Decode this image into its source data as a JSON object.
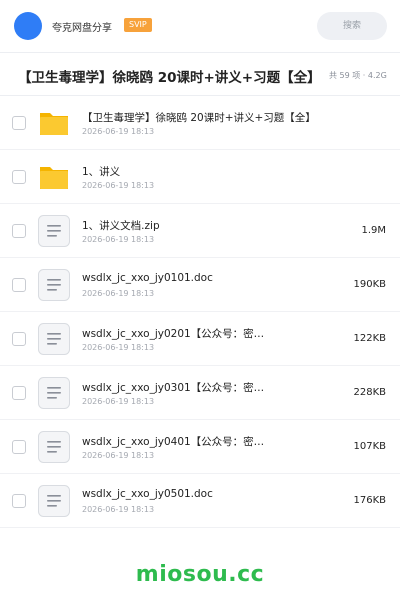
{
  "header": {
    "app_name": "夸克网盘分享",
    "badge": "SVIP",
    "search_placeholder": "搜索"
  },
  "share": {
    "title": "【卫生毒理学】徐晓鸥 20课时+讲义+习题【全】",
    "summary": "共 59 项 · 4.2G"
  },
  "files": [
    {
      "name": "【卫生毒理学】徐晓鸥 20课时+讲义+习题【全】",
      "date": "2026-06-19 18:13",
      "size": "",
      "type": "folder"
    },
    {
      "name": "1、讲义",
      "date": "2026-06-19 18:13",
      "size": "",
      "type": "folder"
    },
    {
      "name": "1、讲义文档.zip",
      "date": "2026-06-19 18:13",
      "size": "1.9M",
      "type": "file"
    },
    {
      "name": "wsdlx_jc_xxo_jy0101.doc",
      "date": "2026-06-19 18:13",
      "size": "190KB",
      "type": "file"
    },
    {
      "name": "wsdlx_jc_xxo_jy0201【公众号：密…",
      "date": "2026-06-19 18:13",
      "size": "122KB",
      "type": "file"
    },
    {
      "name": "wsdlx_jc_xxo_jy0301【公众号：密…",
      "date": "2026-06-19 18:13",
      "size": "228KB",
      "type": "file"
    },
    {
      "name": "wsdlx_jc_xxo_jy0401【公众号：密…",
      "date": "2026-06-19 18:13",
      "size": "107KB",
      "type": "file"
    },
    {
      "name": "wsdlx_jc_xxo_jy0501.doc",
      "date": "2026-06-19 18:13",
      "size": "176KB",
      "type": "file"
    }
  ],
  "watermark": "miosou.cc",
  "colors": {
    "accent": "#2f7df6",
    "svip": "#f7a23b",
    "folder": "#fbc02d",
    "watermark": "#2ebb4e"
  }
}
